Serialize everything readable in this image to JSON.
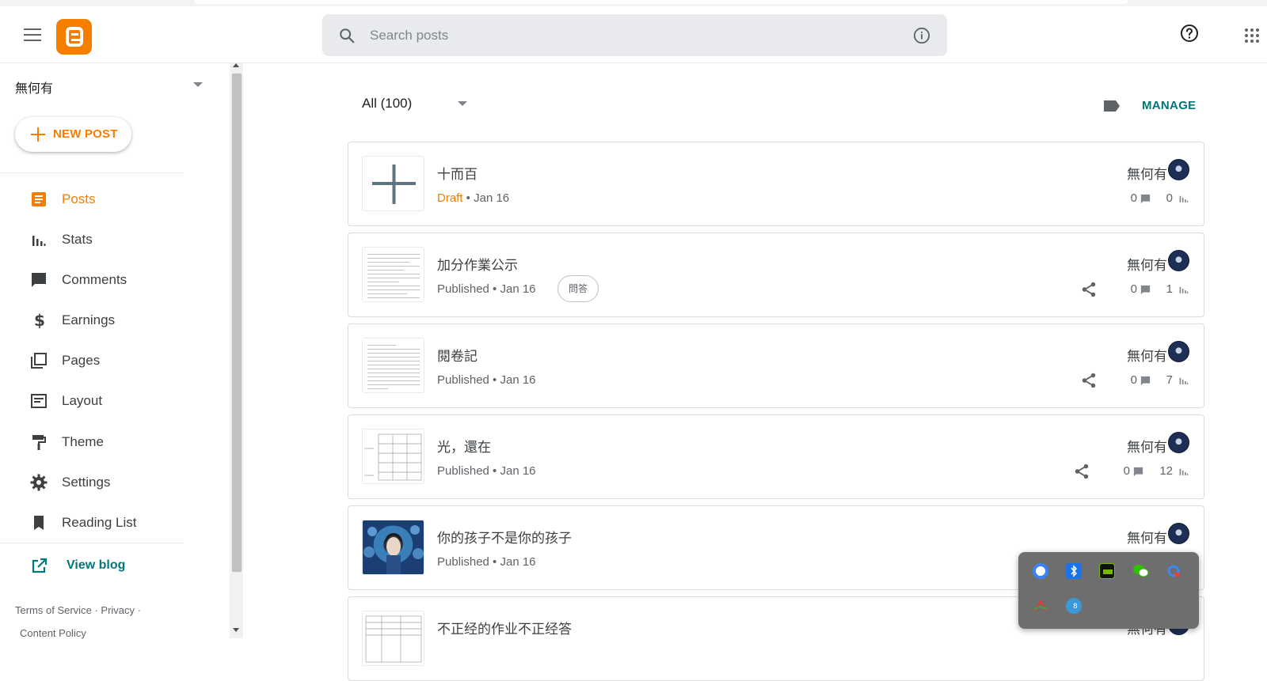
{
  "header": {
    "search_placeholder": "Search posts",
    "menu_icon": "menu-icon",
    "logo_icon": "blogger-logo",
    "help_icon": "help-icon",
    "apps_icon": "apps-grid-icon"
  },
  "sidebar": {
    "blog_name": "無何有",
    "new_post_label": "NEW POST",
    "items": [
      {
        "label": "Posts",
        "icon": "posts-icon",
        "active": true
      },
      {
        "label": "Stats",
        "icon": "stats-icon",
        "active": false
      },
      {
        "label": "Comments",
        "icon": "comments-icon",
        "active": false
      },
      {
        "label": "Earnings",
        "icon": "dollar-icon",
        "active": false
      },
      {
        "label": "Pages",
        "icon": "pages-icon",
        "active": false
      },
      {
        "label": "Layout",
        "icon": "layout-icon",
        "active": false
      },
      {
        "label": "Theme",
        "icon": "paint-roller-icon",
        "active": false
      },
      {
        "label": "Settings",
        "icon": "gear-icon",
        "active": false
      },
      {
        "label": "Reading List",
        "icon": "bookmark-icon",
        "active": false
      }
    ],
    "view_blog_label": "View blog",
    "footer": {
      "terms": "Terms of Service",
      "sep1": "·",
      "privacy": "Privacy",
      "sep2": "·",
      "content_policy": "Content Policy"
    }
  },
  "main": {
    "filter_label": "All (100)",
    "manage_label": "MANAGE",
    "posts": [
      {
        "title": "十而百",
        "status": "Draft",
        "date": "Jan 16",
        "author": "無何有",
        "comments": "0",
        "views": "0",
        "tag": "",
        "thumbnail": "add-image-placeholder",
        "shareable": false
      },
      {
        "title": "加分作業公示",
        "status": "Published",
        "date": "Jan 16",
        "author": "無何有",
        "comments": "0",
        "views": "1",
        "tag": "問答",
        "thumbnail": "document-scan",
        "shareable": true
      },
      {
        "title": "閱卷記",
        "status": "Published",
        "date": "Jan 16",
        "author": "無何有",
        "comments": "0",
        "views": "7",
        "tag": "",
        "thumbnail": "document-scan",
        "shareable": true
      },
      {
        "title": "光，還在",
        "status": "Published",
        "date": "Jan 16",
        "author": "無何有",
        "comments": "0",
        "views": "12",
        "tag": "",
        "thumbnail": "table-scan",
        "shareable": true
      },
      {
        "title": "你的孩子不是你的孩子",
        "status": "Published",
        "date": "Jan 16",
        "author": "無何有",
        "comments": "",
        "views": "",
        "tag": "",
        "thumbnail": "photo",
        "shareable": false
      },
      {
        "title": "不正经的作业不正经答",
        "status": "",
        "date": "",
        "author": "無何有",
        "comments": "",
        "views": "",
        "tag": "",
        "thumbnail": "table-scan",
        "shareable": false
      }
    ]
  },
  "system_tray": {
    "icons": [
      "signal-icon",
      "bluetooth-icon",
      "nvidia-icon",
      "wechat-icon",
      "google-drive-icon",
      "adobe-icon",
      "network-badge-icon"
    ],
    "badge_text": "8"
  },
  "colors": {
    "accent": "#f57d00",
    "teal": "#00777b",
    "search_bg": "#e8eaed"
  }
}
